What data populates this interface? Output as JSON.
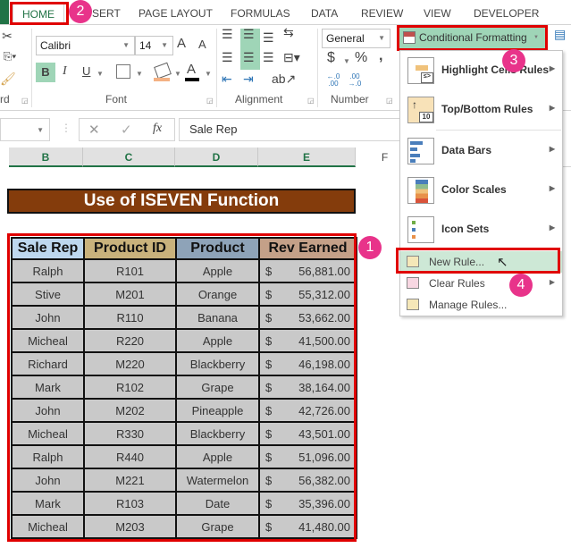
{
  "tabs": [
    {
      "label": "HOME",
      "active": true
    },
    {
      "label": "INSERT"
    },
    {
      "label": "PAGE LAYOUT"
    },
    {
      "label": "FORMULAS"
    },
    {
      "label": "DATA"
    },
    {
      "label": "REVIEW"
    },
    {
      "label": "VIEW"
    },
    {
      "label": "DEVELOPER"
    }
  ],
  "tab_insert_visible": "SERT",
  "ribbon": {
    "clipboard_label": "rd",
    "font": {
      "name": "Calibri",
      "size": "14",
      "label": "Font",
      "bold": "B",
      "italic": "I",
      "underline": "U",
      "grow": "A",
      "shrink": "A",
      "font_color": "A"
    },
    "alignment_label": "Alignment",
    "number": {
      "format": "General",
      "currency": "$",
      "percent": "%",
      "comma": ",",
      "inc": "←.0 .00",
      "dec": ".00 →.0",
      "label": "Number"
    },
    "conditional_formatting": "Conditional Formatting"
  },
  "formula_bar": {
    "cancel": "✕",
    "enter": "✓",
    "fx": "fx",
    "value": "Sale Rep"
  },
  "columns": [
    "B",
    "C",
    "D",
    "E",
    "F"
  ],
  "title": "Use of ISEVEN Function",
  "table": {
    "headers": [
      "Sale Rep",
      "Product ID",
      "Product",
      "Rev Earned"
    ],
    "header_colors": [
      "#bdd7ee",
      "#c9b27c",
      "#8ea3b8",
      "#c4a088"
    ],
    "rows": [
      [
        "Ralph",
        "R101",
        "Apple",
        "$",
        "56,881.00"
      ],
      [
        "Stive",
        "M201",
        "Orange",
        "$",
        "55,312.00"
      ],
      [
        "John",
        "R110",
        "Banana",
        "$",
        "53,662.00"
      ],
      [
        "Micheal",
        "R220",
        "Apple",
        "$",
        "41,500.00"
      ],
      [
        "Richard",
        "M220",
        "Blackberry",
        "$",
        "46,198.00"
      ],
      [
        "Mark",
        "R102",
        "Grape",
        "$",
        "38,164.00"
      ],
      [
        "John",
        "M202",
        "Pineapple",
        "$",
        "42,726.00"
      ],
      [
        "Micheal",
        "R330",
        "Blackberry",
        "$",
        "43,501.00"
      ],
      [
        "Ralph",
        "R440",
        "Apple",
        "$",
        "51,096.00"
      ],
      [
        "John",
        "M221",
        "Watermelon",
        "$",
        "56,382.00"
      ],
      [
        "Mark",
        "R103",
        "Date",
        "$",
        "35,396.00"
      ],
      [
        "Micheal",
        "M203",
        "Grape",
        "$",
        "41,480.00"
      ]
    ]
  },
  "menu": {
    "items": [
      {
        "label": "Highlight Cells Rules",
        "icon": "highlight-cells-icon"
      },
      {
        "label": "Top/Bottom Rules",
        "icon": "top-bottom-icon"
      },
      {
        "label": "Data Bars",
        "icon": "data-bars-icon"
      },
      {
        "label": "Color Scales",
        "icon": "color-scales-icon"
      },
      {
        "label": "Icon Sets",
        "icon": "icon-sets-icon"
      }
    ],
    "new_rule": "New Rule...",
    "clear_rules": "Clear Rules",
    "manage_rules": "Manage Rules..."
  },
  "badges": [
    "1",
    "2",
    "3",
    "4"
  ],
  "colors": {
    "accent": "#217346",
    "highlight": "#e00000",
    "badge": "#e8338a",
    "title_bg": "#843c0c"
  }
}
